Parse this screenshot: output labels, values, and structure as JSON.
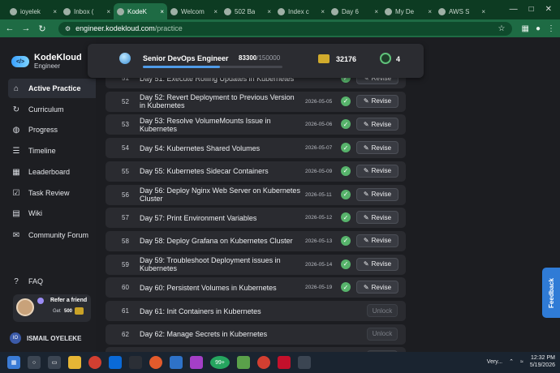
{
  "browser": {
    "tabs": [
      {
        "label": "ioyelek"
      },
      {
        "label": "Inbox ("
      },
      {
        "label": "KodeK",
        "active": true
      },
      {
        "label": "Welcom"
      },
      {
        "label": "502 Ba"
      },
      {
        "label": "Index c"
      },
      {
        "label": "Day 6"
      },
      {
        "label": "My De"
      },
      {
        "label": "AWS S"
      }
    ],
    "url_host": "engineer.kodekloud.com",
    "url_path": "/practice"
  },
  "sidebar": {
    "brand": "KodeKloud",
    "brand_sub": "Engineer",
    "brand_mark": "</>",
    "items": [
      {
        "label": "Active Practice",
        "icon": "home-icon",
        "active": true
      },
      {
        "label": "Curriculum",
        "icon": "curriculum-icon"
      },
      {
        "label": "Progress",
        "icon": "progress-icon"
      },
      {
        "label": "Timeline",
        "icon": "timeline-icon"
      },
      {
        "label": "Leaderboard",
        "icon": "leaderboard-icon"
      },
      {
        "label": "Task Review",
        "icon": "task-review-icon"
      },
      {
        "label": "Wiki",
        "icon": "wiki-icon"
      },
      {
        "label": "Community Forum",
        "icon": "forum-icon"
      }
    ],
    "faq": "FAQ",
    "refer": {
      "title": "Refer a friend",
      "get": "Get",
      "amount": "500"
    },
    "user": {
      "initials": "IO",
      "name": "ISMAIL OYELEKE"
    }
  },
  "header": {
    "level": "Senior DevOps Engineer",
    "points": "83300",
    "points_total": "/150000",
    "progress": 0.555,
    "coins": "32176",
    "badges": "4"
  },
  "tasks": [
    {
      "num": "51",
      "title": "Day 51: Execute Rolling Updates in Kubernetes",
      "date": "",
      "status": "done"
    },
    {
      "num": "52",
      "title": "Day 52: Revert Deployment to Previous Version in Kubernetes",
      "date": "2026-05-05",
      "status": "done"
    },
    {
      "num": "53",
      "title": "Day 53: Resolve VolumeMounts Issue in Kubernetes",
      "date": "2026-05-06",
      "status": "done"
    },
    {
      "num": "54",
      "title": "Day 54: Kubernetes Shared Volumes",
      "date": "2026-05-07",
      "status": "done"
    },
    {
      "num": "55",
      "title": "Day 55: Kubernetes Sidecar Containers",
      "date": "2026-05-09",
      "status": "done"
    },
    {
      "num": "56",
      "title": "Day 56: Deploy Nginx Web Server on Kubernetes Cluster",
      "date": "2026-05-11",
      "status": "done"
    },
    {
      "num": "57",
      "title": "Day 57: Print Environment Variables",
      "date": "2026-05-12",
      "status": "done"
    },
    {
      "num": "58",
      "title": "Day 58: Deploy Grafana on Kubernetes Cluster",
      "date": "2026-05-13",
      "status": "done"
    },
    {
      "num": "59",
      "title": "Day 59: Troubleshoot Deployment issues in Kubernetes",
      "date": "2026-05-14",
      "status": "done"
    },
    {
      "num": "60",
      "title": "Day 60: Persistent Volumes in Kubernetes",
      "date": "2026-05-19",
      "status": "done"
    },
    {
      "num": "61",
      "title": "Day 61: Init Containers in Kubernetes",
      "date": "",
      "status": "locked"
    },
    {
      "num": "62",
      "title": "Day 62: Manage Secrets in Kubernetes",
      "date": "",
      "status": "locked"
    },
    {
      "num": "63",
      "title": "Day 63: Deploy Iron Gallery App on Kubernetes",
      "date": "",
      "status": "locked"
    }
  ],
  "labels": {
    "revise": "Revise",
    "unlock": "Unlock",
    "feedback": "Feedback"
  },
  "taskbar": {
    "badge": "99+",
    "weather": "Very...",
    "time": "12:32 PM",
    "date": "5/19/2026"
  }
}
